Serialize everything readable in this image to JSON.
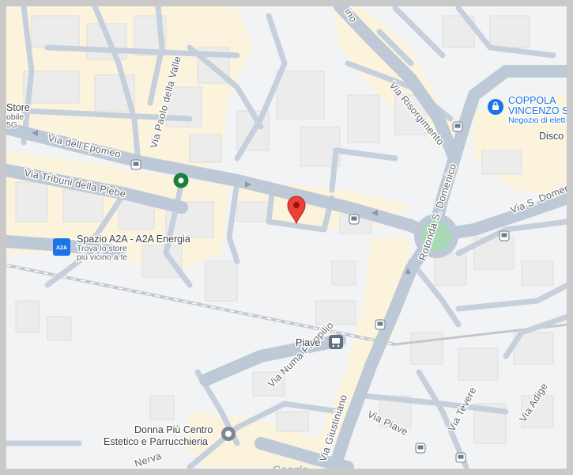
{
  "map": {
    "streets": {
      "via_dell_epomeo": "Via dell'Epomeo",
      "via_tribuni_della_plebe": "Via Tribuni della Plebe",
      "via_paolo_della_valle": "Via Paolo della Valle",
      "via_risorgimento": "Via Risorgimento",
      "rotonda_s_domenico": "Rotonda S. Domenico",
      "via_s_domenico": "Via S. Domeni",
      "via_numa_pompilio": "Via Numa Pompilio",
      "via_giustiniano": "Via Giustiniano",
      "via_piave": "Via Piave",
      "via_tevere": "Via Tevere",
      "via_adige": "Via Adige",
      "nerva": "Nerva",
      "top_fragment": "ino"
    },
    "pois": {
      "coppola": {
        "name_line1": "COPPOLA",
        "name_line2": "VINCENZO S",
        "subtitle": "Negozio di elett"
      },
      "spazio_a2a": {
        "name": "Spazio A2A - A2A Energia",
        "subtitle_line1": "Trova lo store",
        "subtitle_line2": "più vicino a te",
        "logo_text": "A2A"
      },
      "donna_piu": {
        "name_line1": "Donna Più Centro",
        "name_line2": "Estetico e Parrucchieria"
      },
      "piave_stop": {
        "name": "Piave"
      },
      "store_fragment": {
        "line1": "Store",
        "line2": "obile",
        "line3": "5G"
      },
      "disco_fragment": {
        "name": "Disco"
      }
    },
    "attribution": {
      "google": "Google"
    },
    "colors": {
      "background": "#f1f3f4",
      "road": "#bdc9d6",
      "building": "#ececec",
      "cream_area": "#fcf3dd",
      "pin": "#ea4335",
      "green_poi": "#188038",
      "blue_poi": "#1a73e8",
      "roundabout": "#a8dab5"
    },
    "icons": [
      "location-pin-icon",
      "green-poi-icon",
      "shopping-bag-icon",
      "bus-stop-icon",
      "tram-stop-icon",
      "a2a-logo-icon",
      "salon-poi-icon"
    ]
  }
}
